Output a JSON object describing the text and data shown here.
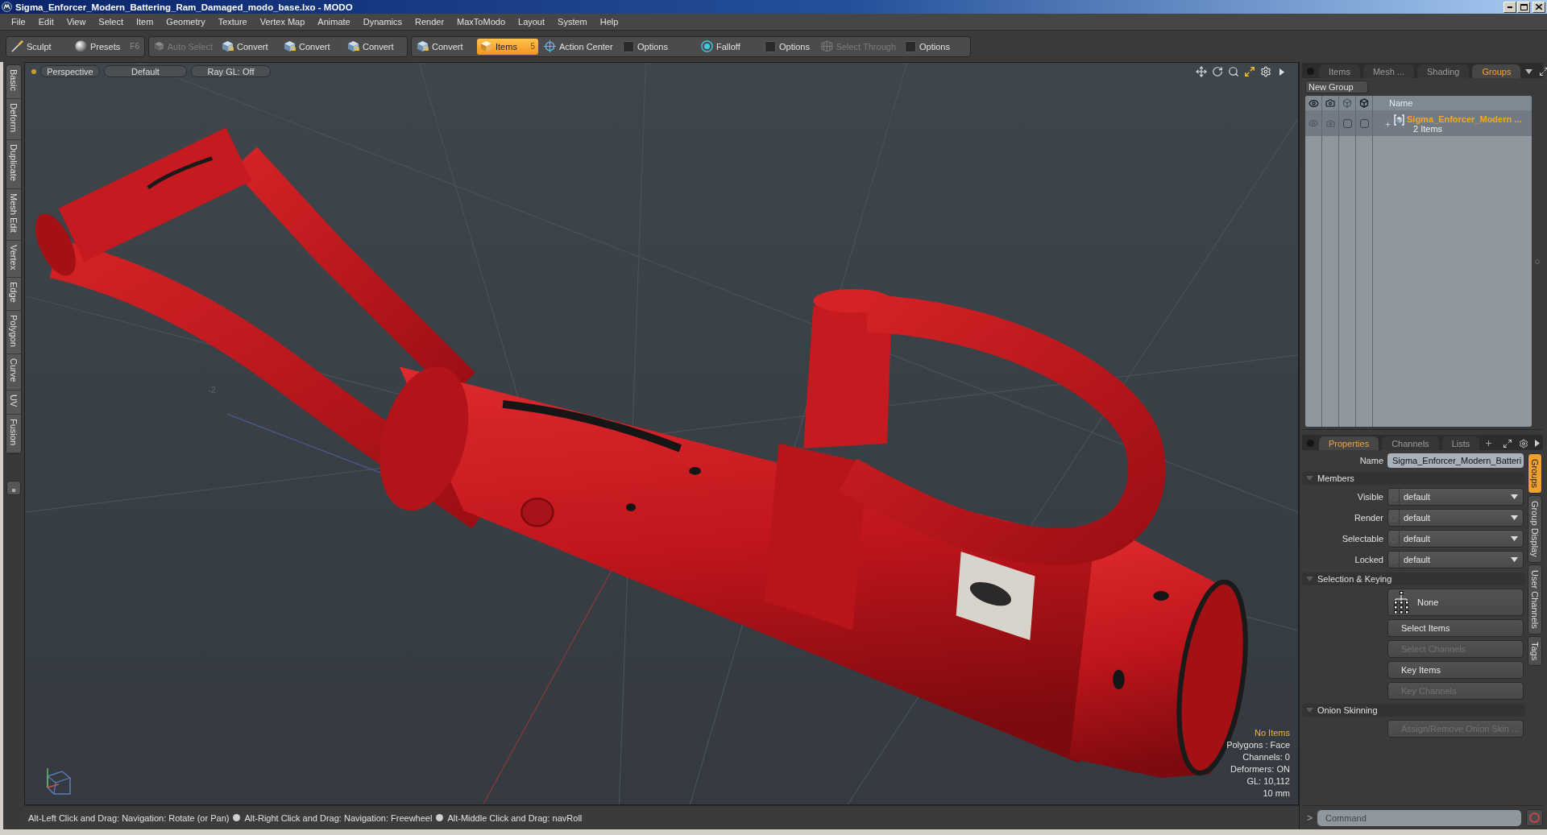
{
  "window": {
    "title": "Sigma_Enforcer_Modern_Battering_Ram_Damaged_modo_base.lxo - MODO"
  },
  "menu": [
    "File",
    "Edit",
    "View",
    "Select",
    "Item",
    "Geometry",
    "Texture",
    "Vertex Map",
    "Animate",
    "Dynamics",
    "Render",
    "MaxToModo",
    "Layout",
    "System",
    "Help"
  ],
  "toolbar": [
    [
      {
        "kind": "sculpt",
        "label": "Sculpt",
        "selected": false,
        "disabled": false
      },
      {
        "kind": "presets",
        "label": "Presets",
        "shortcut": "F6",
        "selected": false,
        "disabled": false
      }
    ],
    [
      {
        "kind": "autoselect",
        "label": "Auto Select",
        "selected": false,
        "disabled": true
      },
      {
        "kind": "convert",
        "label": "Convert",
        "selected": false,
        "disabled": false
      },
      {
        "kind": "convert",
        "label": "Convert",
        "selected": false,
        "disabled": false
      },
      {
        "kind": "convert",
        "label": "Convert",
        "selected": false,
        "disabled": false
      }
    ],
    [
      {
        "kind": "convert",
        "label": "Convert",
        "selected": false,
        "disabled": false
      },
      {
        "kind": "items",
        "label": "Items",
        "shortcut": "5",
        "selected": true,
        "disabled": false
      },
      {
        "kind": "center",
        "label": "Action Center",
        "selected": false,
        "disabled": false
      },
      {
        "kind": "options",
        "label": "Options",
        "selected": false,
        "disabled": false
      },
      {
        "kind": "falloff",
        "label": "Falloff",
        "selected": false,
        "disabled": false
      },
      {
        "kind": "options",
        "label": "Options",
        "selected": false,
        "disabled": false
      },
      {
        "kind": "through",
        "label": "Select Through",
        "selected": false,
        "disabled": true
      },
      {
        "kind": "options",
        "label": "Options",
        "selected": false,
        "disabled": false
      }
    ]
  ],
  "tool_tabs": [
    "Basic",
    "Deform",
    "Duplicate",
    "Mesh Edit",
    "Vertex",
    "Edge",
    "Polygon",
    "Curve",
    "UV",
    "Fusion"
  ],
  "viewport": {
    "header": [
      "Perspective",
      "Default",
      "Ray GL: Off"
    ],
    "grid_label": "-2",
    "stats": [
      {
        "text": "No Items",
        "highlighted": true
      },
      {
        "text": "Polygons : Face",
        "highlighted": false
      },
      {
        "text": "Channels: 0",
        "highlighted": false
      },
      {
        "text": "Deformers: ON",
        "highlighted": false
      },
      {
        "text": "GL: 10,112",
        "highlighted": false
      },
      {
        "text": "10 mm",
        "highlighted": false
      }
    ]
  },
  "status_bar": {
    "hints": [
      "Alt-Left Click and Drag: Navigation: Rotate (or Pan)",
      "Alt-Right Click and Drag: Navigation: Freewheel",
      "Alt-Middle Click and Drag: navRoll"
    ]
  },
  "groups_panel": {
    "tabs": [
      {
        "label": "Items",
        "selected": false
      },
      {
        "label": "Mesh ...",
        "selected": false
      },
      {
        "label": "Shading",
        "selected": false
      },
      {
        "label": "Groups",
        "selected": true
      }
    ],
    "new_group": "New Group",
    "name_column": "Name",
    "rows": [
      {
        "name": "Sigma_Enforcer_Modern ...",
        "count": "2 Items",
        "selected": true
      }
    ]
  },
  "properties_panel": {
    "tabs": [
      {
        "label": "Properties",
        "selected": true
      },
      {
        "label": "Channels",
        "selected": false
      },
      {
        "label": "Lists",
        "selected": false
      }
    ],
    "name_field": {
      "label": "Name",
      "value": "Sigma_Enforcer_Modern_Batteri"
    },
    "sections": [
      {
        "title": "Members",
        "expanded": true,
        "rows": [
          {
            "kind": "dropdown",
            "label": "Visible",
            "value": "default"
          },
          {
            "kind": "dropdown",
            "label": "Render",
            "value": "default"
          },
          {
            "kind": "dropdown",
            "label": "Selectable",
            "value": "default"
          },
          {
            "kind": "dropdown",
            "label": "Locked",
            "value": "default"
          }
        ]
      },
      {
        "title": "Selection & Keying",
        "expanded": true,
        "rows": [
          {
            "kind": "hierarchy",
            "label": "None",
            "disabled": false
          },
          {
            "kind": "button",
            "label": "Select Items",
            "disabled": false
          },
          {
            "kind": "button",
            "label": "Select Channels",
            "disabled": true
          },
          {
            "kind": "button",
            "label": "Key Items",
            "disabled": false
          },
          {
            "kind": "button",
            "label": "Key Channels",
            "disabled": true
          }
        ]
      },
      {
        "title": "Onion Skinning",
        "expanded": true,
        "rows": [
          {
            "kind": "button",
            "label": "Assign/Remove Onion Skin ...",
            "disabled": true
          }
        ]
      }
    ],
    "side_tabs": [
      {
        "label": "Groups",
        "selected": true
      },
      {
        "label": "Group Display",
        "selected": false
      },
      {
        "label": "User Channels",
        "selected": false
      },
      {
        "label": "Tags",
        "selected": false
      }
    ]
  },
  "command": {
    "prompt": ">",
    "placeholder": "Command"
  }
}
